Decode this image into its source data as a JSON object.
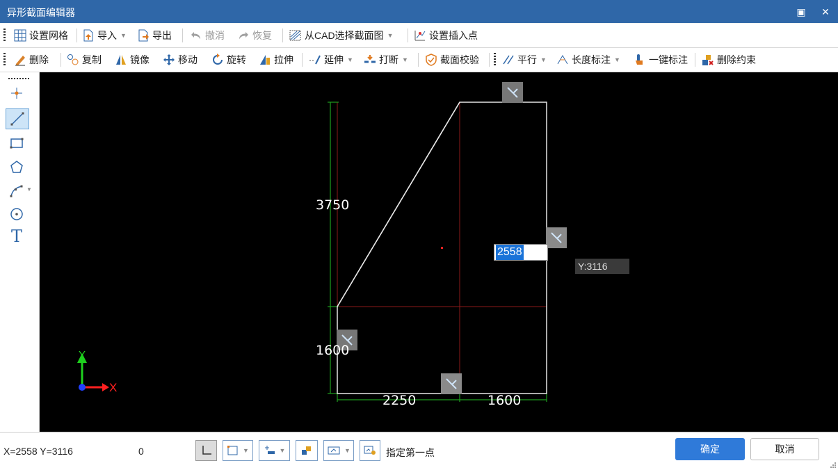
{
  "window": {
    "title": "异形截面编辑器",
    "restore_glyph": "▣",
    "close_glyph": "✕"
  },
  "toolbar1": [
    {
      "label": "设置网格",
      "icon": "grid-icon"
    },
    {
      "label": "导入",
      "icon": "import-icon",
      "dropdown": true
    },
    {
      "label": "导出",
      "icon": "export-icon"
    },
    {
      "label": "撤消",
      "icon": "undo-icon",
      "disabled": true
    },
    {
      "label": "恢复",
      "icon": "redo-icon",
      "disabled": true
    },
    {
      "label": "从CAD选择截面图",
      "icon": "cad-select-icon",
      "dropdown": true
    },
    {
      "label": "设置插入点",
      "icon": "insert-point-icon"
    }
  ],
  "toolbar2": [
    {
      "label": "删除",
      "icon": "eraser-icon"
    },
    {
      "label": "复制",
      "icon": "copy-icon"
    },
    {
      "label": "镜像",
      "icon": "mirror-icon"
    },
    {
      "label": "移动",
      "icon": "move-icon"
    },
    {
      "label": "旋转",
      "icon": "rotate-icon"
    },
    {
      "label": "拉伸",
      "icon": "stretch-icon"
    },
    {
      "label": "延伸",
      "icon": "extend-icon",
      "dropdown": true
    },
    {
      "label": "打断",
      "icon": "break-icon",
      "dropdown": true
    },
    {
      "label": "截面校验",
      "icon": "check-shield-icon"
    },
    {
      "label": "平行",
      "icon": "parallel-icon",
      "dropdown": true
    },
    {
      "label": "长度标注",
      "icon": "length-dim-icon",
      "dropdown": true
    },
    {
      "label": "一键标注",
      "icon": "one-click-dim-icon"
    },
    {
      "label": "删除约束",
      "icon": "delete-constraint-icon"
    }
  ],
  "left_tools": [
    {
      "name": "point-tool",
      "icon": "point-icon"
    },
    {
      "name": "line-tool",
      "icon": "line-icon",
      "active": true
    },
    {
      "name": "rectangle-tool",
      "icon": "rectangle-icon"
    },
    {
      "name": "polygon-tool",
      "icon": "polygon-icon"
    },
    {
      "name": "polyline-tool",
      "icon": "polyline-icon",
      "dropdown": true
    },
    {
      "name": "circle-tool",
      "icon": "circle-icon"
    },
    {
      "name": "text-tool",
      "icon": "text-icon",
      "glyph": "T"
    }
  ],
  "canvas": {
    "dimensions": {
      "left_upper": "3750",
      "left_lower": "1600",
      "bottom_left": "2250",
      "bottom_right": "1600"
    },
    "input_value": "2558",
    "y_tooltip": "Y:3116",
    "axis": {
      "x_label": "X",
      "y_label": "Y"
    },
    "colors": {
      "background": "#000000",
      "outline": "#e6e6e6",
      "construction": "#8b1a1a",
      "dimension": "#1e9e1e",
      "handle": "#777777"
    }
  },
  "statusbar": {
    "coords": "X=2558 Y=3116",
    "count": "0",
    "prompt": "指定第一点",
    "ok_label": "确定",
    "cancel_label": "取消"
  },
  "colors": {
    "title_bar": "#2f67a8",
    "primary_button": "#2f7ad9"
  }
}
